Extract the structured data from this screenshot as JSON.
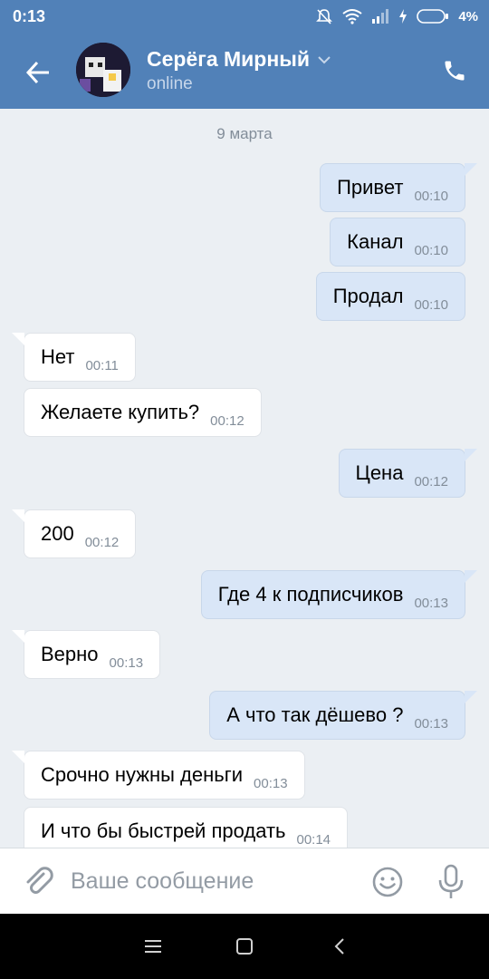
{
  "status_bar": {
    "time": "0:13",
    "battery": "4%"
  },
  "header": {
    "contact_name": "Серёга Мирный",
    "contact_status": "online"
  },
  "chat": {
    "date_label": "9 марта",
    "messages": [
      {
        "direction": "out",
        "text": "Привет",
        "time": "00:10"
      },
      {
        "direction": "out",
        "text": "Канал",
        "time": "00:10"
      },
      {
        "direction": "out",
        "text": "Продал",
        "time": "00:10"
      },
      {
        "direction": "in",
        "text": "Нет",
        "time": "00:11"
      },
      {
        "direction": "in",
        "text": "Желаете купить?",
        "time": "00:12"
      },
      {
        "direction": "out",
        "text": "Цена",
        "time": "00:12"
      },
      {
        "direction": "in",
        "text": "200",
        "time": "00:12"
      },
      {
        "direction": "out",
        "text": "Где 4 к подписчиков",
        "time": "00:13"
      },
      {
        "direction": "in",
        "text": "Верно",
        "time": "00:13"
      },
      {
        "direction": "out",
        "text": "А что так дёшево ?",
        "time": "00:13"
      },
      {
        "direction": "in",
        "text": "Срочно нужны деньги",
        "time": "00:13"
      },
      {
        "direction": "in",
        "text": "И что бы быстрей продать",
        "time": "00:14"
      }
    ]
  },
  "input": {
    "placeholder": "Ваше сообщение"
  },
  "icons": {
    "back": "arrow-left-icon",
    "call": "phone-icon",
    "attach": "paperclip-icon",
    "emoji": "smiley-icon",
    "mic": "microphone-icon",
    "nav_menu": "menu-icon",
    "nav_home": "square-icon",
    "nav_back": "chevron-left-icon"
  },
  "colors": {
    "header": "#5181b8",
    "background": "#ebeff3",
    "outgoing_bubble": "#d9e6f7",
    "incoming_bubble": "#ffffff"
  }
}
